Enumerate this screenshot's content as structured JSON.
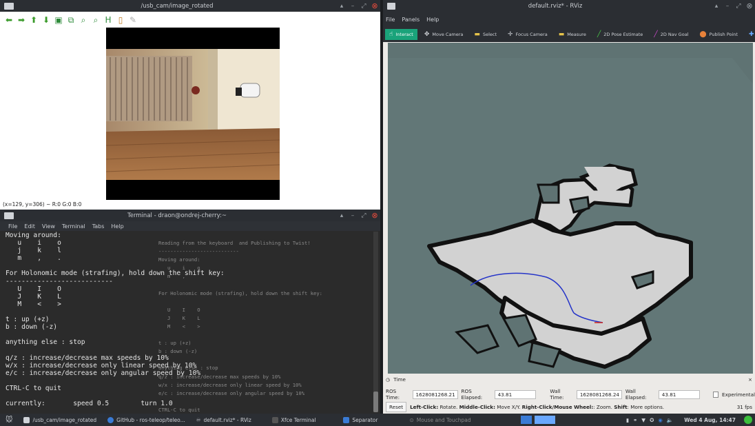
{
  "image_view": {
    "title": "/usb_cam/image_rotated",
    "status": "(x=129, y=306) ~ R:0 G:0 B:0",
    "toolbar_icons": [
      "arrow-left-icon",
      "arrow-right-icon",
      "arrow-up-icon",
      "arrow-down-icon",
      "image-icon",
      "fit-icon",
      "zoom-in-icon",
      "zoom-out-icon",
      "save-icon",
      "clipboard-icon",
      "brush-icon"
    ]
  },
  "terminal": {
    "title": "Terminal - draon@ondrej-cherry:~",
    "menu": [
      "File",
      "Edit",
      "View",
      "Terminal",
      "Tabs",
      "Help"
    ],
    "lines": [
      "Moving around:",
      "   u    i    o",
      "   j    k    l",
      "   m    ,    .",
      "",
      "For Holonomic mode (strafing), hold down the shift key:",
      "---------------------------",
      "   U    I    O",
      "   J    K    L",
      "   M    <    >",
      "",
      "t : up (+z)",
      "b : down (-z)",
      "",
      "anything else : stop",
      "",
      "q/z : increase/decrease max speeds by 10%",
      "w/x : increase/decrease only linear speed by 10%",
      "e/c : increase/decrease only angular speed by 10%",
      "",
      "CTRL-C to quit",
      "",
      "currently:       speed 0.5        turn 1.0"
    ],
    "ghost_lines": [
      "Reading from the keyboard  and Publishing to Twist!",
      "---------------------------",
      "Moving around:",
      "   u    i    o",
      "   m    ,",
      "",
      "For Holonomic mode (strafing), hold down the shift key:",
      "",
      "   U    I    O",
      "   J    K    L",
      "   M    <    >",
      "",
      "t : up (+z)",
      "b : down (-z)",
      "",
      "anything else : stop",
      "q/z : increase/decrease max speeds by 10%",
      "w/x : increase/decrease only linear speed by 10%",
      "e/c : increase/decrease only angular speed by 10%",
      "",
      "CTRL-C to quit"
    ]
  },
  "rviz": {
    "title": "default.rviz* - RViz",
    "menu": [
      "File",
      "Panels",
      "Help"
    ],
    "tools": [
      {
        "label": "Interact",
        "icon": "interact-icon",
        "active": true
      },
      {
        "label": "Move Camera",
        "icon": "move-camera-icon",
        "active": false
      },
      {
        "label": "Select",
        "icon": "select-icon",
        "active": false
      },
      {
        "label": "Focus Camera",
        "icon": "focus-camera-icon",
        "active": false
      },
      {
        "label": "Measure",
        "icon": "measure-icon",
        "active": false
      },
      {
        "label": "2D Pose Estimate",
        "icon": "pose-estimate-icon",
        "active": false
      },
      {
        "label": "2D Nav Goal",
        "icon": "nav-goal-icon",
        "active": false
      },
      {
        "label": "Publish Point",
        "icon": "publish-point-icon",
        "active": false
      }
    ],
    "time_panel": {
      "title": "Time",
      "ros_time_label": "ROS Time:",
      "ros_time": "1628081268.21",
      "ros_elapsed_label": "ROS Elapsed:",
      "ros_elapsed": "43.81",
      "wall_time_label": "Wall Time:",
      "wall_time": "1628081268.24",
      "wall_elapsed_label": "Wall Elapsed:",
      "wall_elapsed": "43.81",
      "experimental_label": "Experimental",
      "reset_label": "Reset",
      "hint_bold1": "Left-Click:",
      "hint1": " Rotate. ",
      "hint_bold2": "Middle-Click:",
      "hint2": " Move X/Y. ",
      "hint_bold3": "Right-Click/Mouse Wheel:",
      "hint3": ": Zoom. ",
      "hint_bold4": "Shift",
      "hint4": ": More options.",
      "fps": "31 fps"
    },
    "colors": {
      "ground": "#5f7373",
      "map_free": "#d2d2d2",
      "map_wall": "#111111",
      "path": "#2433c8"
    }
  },
  "taskbar": {
    "tasks": [
      {
        "label": "/usb_cam/image_rotated",
        "icon": "image-view-icon"
      },
      {
        "label": "GitHub - ros-teleop/teleo...",
        "icon": "browser-icon"
      },
      {
        "label": "default.rviz* - RViz",
        "icon": "rviz-icon"
      },
      {
        "label": "Xfce Terminal",
        "icon": "terminal-icon"
      },
      {
        "label": "Separator",
        "icon": "separator-icon"
      },
      {
        "label": "Mouse and Touchpad",
        "icon": "mouse-icon"
      }
    ],
    "clock": "Wed 4 Aug, 14:47"
  }
}
